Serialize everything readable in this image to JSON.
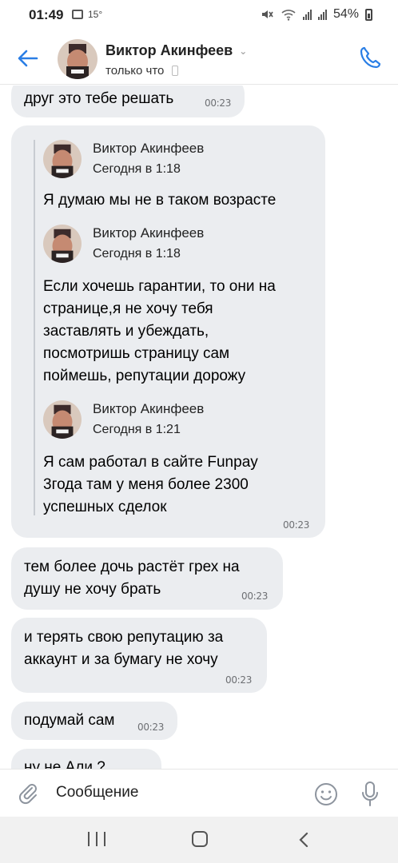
{
  "status_bar": {
    "time": "01:49",
    "temperature": "15°",
    "battery": "54%"
  },
  "header": {
    "contact_name": "Виктор Акинфеев",
    "status": "только что",
    "accent_color": "#2a7ee5"
  },
  "messages": {
    "m0_text": "друг это тебе решать",
    "m0_time": "00:23",
    "fwd_time": "00:23",
    "forwarded": [
      {
        "author": "Виктор Акинфеев",
        "date": "Сегодня в 1:18",
        "text": "Я думаю мы не в таком возрасте"
      },
      {
        "author": "Виктор Акинфеев",
        "date": "Сегодня в 1:18",
        "text": "Если хочешь гарантии, то они на странице,я не хочу тебя заставлять и убеждать, посмотришь страницу сам поймешь, репутации дорожу"
      },
      {
        "author": "Виктор Акинфеев",
        "date": "Сегодня в 1:21",
        "text": "Я сам работал в сайте Funpay 3года там  у меня более 2300 успешных сделок"
      }
    ],
    "m2_text": "тем более дочь растёт грех на душу не хочу брать",
    "m2_time": "00:23",
    "m3_text": "и терять свою репутацию за аккаунт и за бумагу не хочу",
    "m3_time": "00:23",
    "m4_text": "подумай сам",
    "m4_time": "00:23",
    "m5_partial": "ну не Али ?"
  },
  "composer": {
    "placeholder": "Сообщение"
  }
}
